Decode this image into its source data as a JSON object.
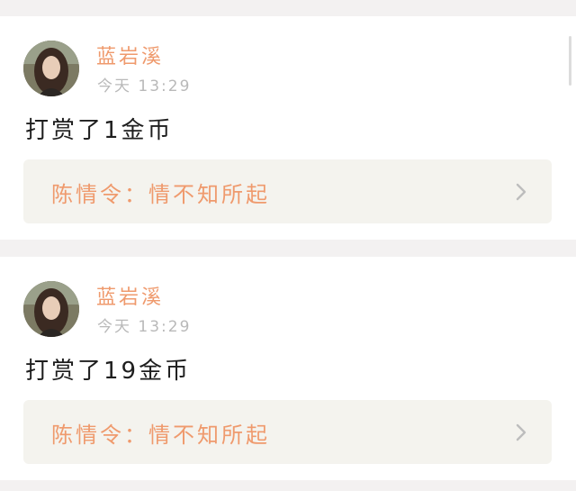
{
  "posts": [
    {
      "username": "蓝岩溪",
      "time": "今天 13:29",
      "message": "打赏了1金币",
      "link": "陈情令：情不知所起",
      "avatar_icon": "user-avatar",
      "arrow_icon": "chevron-right-icon"
    },
    {
      "username": "蓝岩溪",
      "time": "今天 13:29",
      "message": "打赏了19金币",
      "link": "陈情令：情不知所起",
      "avatar_icon": "user-avatar",
      "arrow_icon": "chevron-right-icon"
    }
  ],
  "colors": {
    "accent": "#ef9a6d",
    "background": "#f3f1f1",
    "link_box": "#f4f3ee",
    "muted": "#b9b9b9",
    "text": "#1e1e1e"
  }
}
